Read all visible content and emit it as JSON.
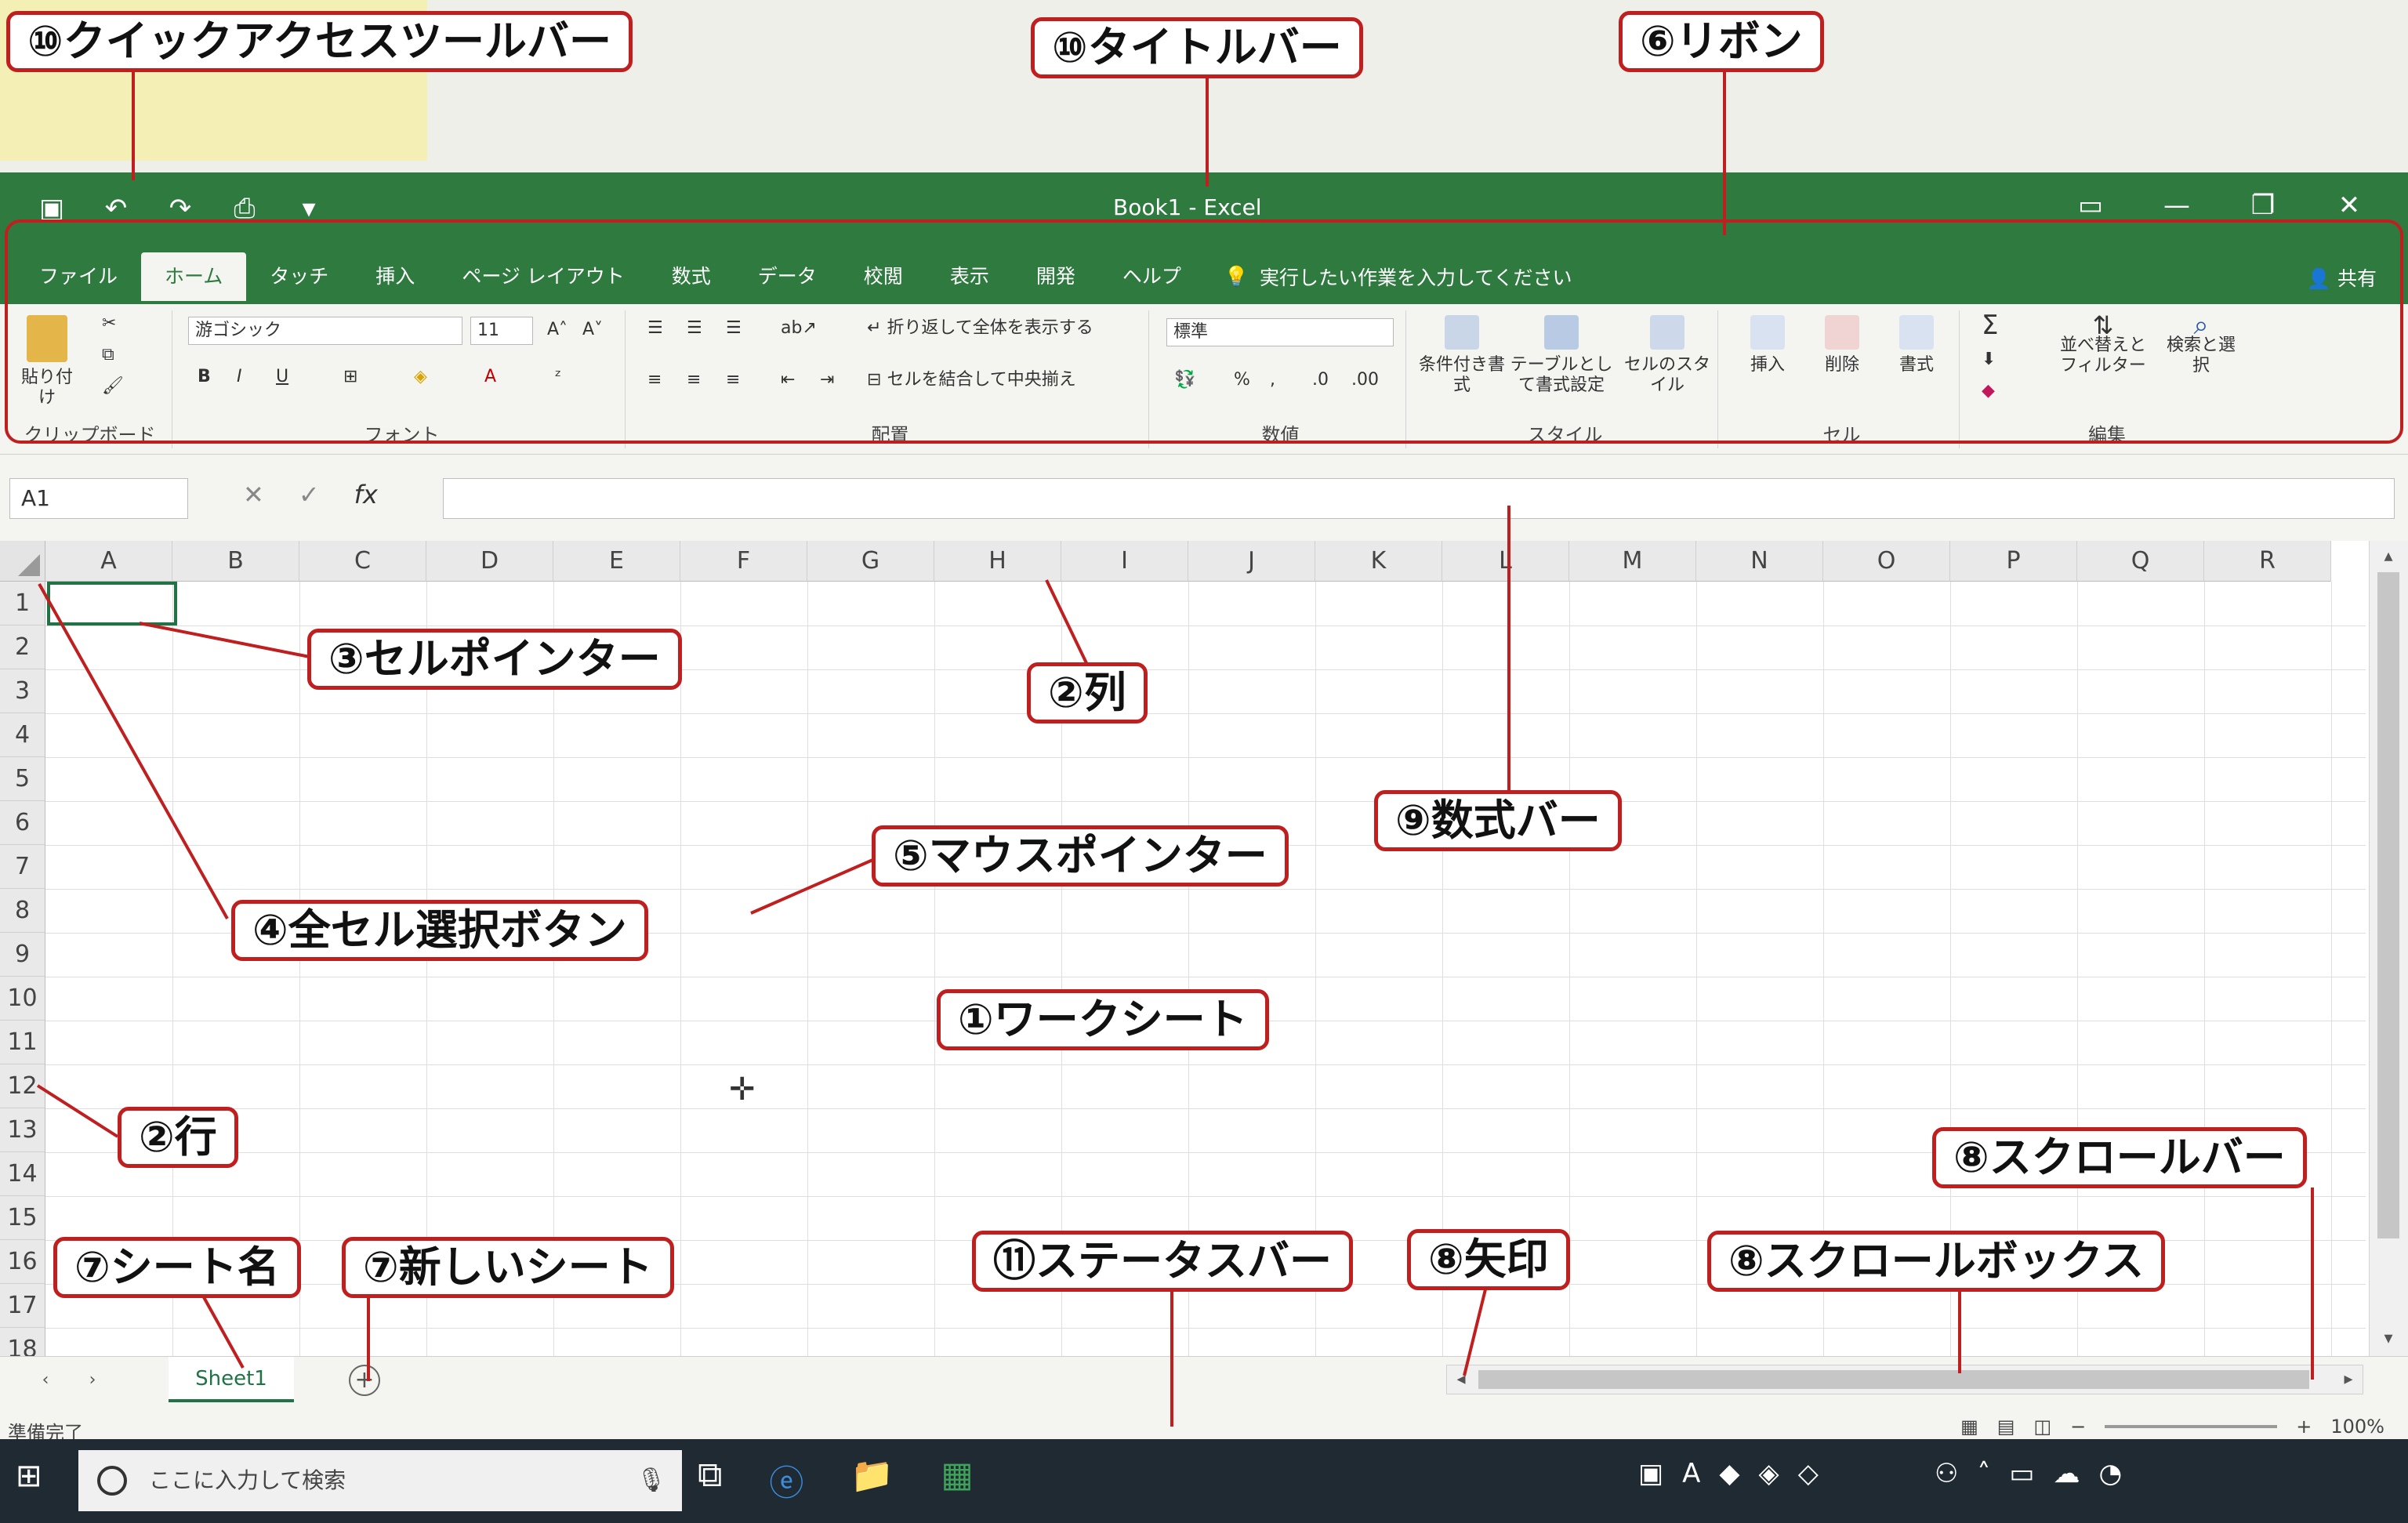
{
  "window": {
    "doc_title": "Book1 - Excel",
    "qat_icons": [
      "save-icon",
      "undo-icon",
      "redo-icon",
      "print-preview-icon",
      "customize-qat-icon"
    ],
    "win_controls": [
      "ribbon-display-icon",
      "minimize-icon",
      "restore-icon",
      "close-icon"
    ]
  },
  "tabs": [
    "ファイル",
    "ホーム",
    "タッチ",
    "挿入",
    "ページ レイアウト",
    "数式",
    "データ",
    "校閲",
    "表示",
    "開発",
    "ヘルプ"
  ],
  "tellme": "実行したい作業を入力してください",
  "share": "共有",
  "ribbon": {
    "clipboard": {
      "paste": "貼り付け",
      "label": "クリップボード"
    },
    "font": {
      "name": "游ゴシック",
      "size": "11",
      "label": "フォント"
    },
    "align": {
      "wrap": "折り返して全体を表示する",
      "merge": "セルを結合して中央揃え",
      "label": "配置"
    },
    "number": {
      "format": "標準",
      "label": "数値"
    },
    "styles": {
      "cond": "条件付き書式",
      "table": "テーブルとして書式設定",
      "cell": "セルのスタイル",
      "label": "スタイル"
    },
    "cells": {
      "insert": "挿入",
      "delete": "削除",
      "format": "書式",
      "label": "セル"
    },
    "edit": {
      "sort": "並べ替えとフィルター",
      "find": "検索と選択",
      "label": "編集"
    }
  },
  "formula": {
    "namebox": "A1",
    "fx": "fx"
  },
  "columns": [
    "A",
    "B",
    "C",
    "D",
    "E",
    "F",
    "G",
    "H",
    "I",
    "J",
    "K",
    "L",
    "M",
    "N",
    "O",
    "P",
    "Q",
    "R"
  ],
  "rows": [
    "1",
    "2",
    "3",
    "4",
    "5",
    "6",
    "7",
    "8",
    "9",
    "10",
    "11",
    "12",
    "13",
    "14",
    "15",
    "16",
    "17",
    "18"
  ],
  "sheet": {
    "name": "Sheet1",
    "new": "+"
  },
  "status": {
    "ready": "準備完了",
    "zoom": "100%"
  },
  "taskbar": {
    "search": "ここに入力して検索"
  },
  "callouts": {
    "qat": "⑩クイックアクセスツールバー",
    "title": "⑩タイトルバー",
    "ribbon": "⑥リボン",
    "cellptr": "③セルポインター",
    "col": "②列",
    "fbar": "⑨数式バー",
    "mouse": "⑤マウスポインター",
    "selall": "④全セル選択ボタン",
    "sheet": "①ワークシート",
    "row": "②行",
    "scrollbar": "⑧スクロールバー",
    "sheetname": "⑦シート名",
    "newsheet": "⑦新しいシート",
    "statusbar": "⑪ステータスバー",
    "arrow": "⑧矢印",
    "scrollbox": "⑧スクロールボックス"
  }
}
